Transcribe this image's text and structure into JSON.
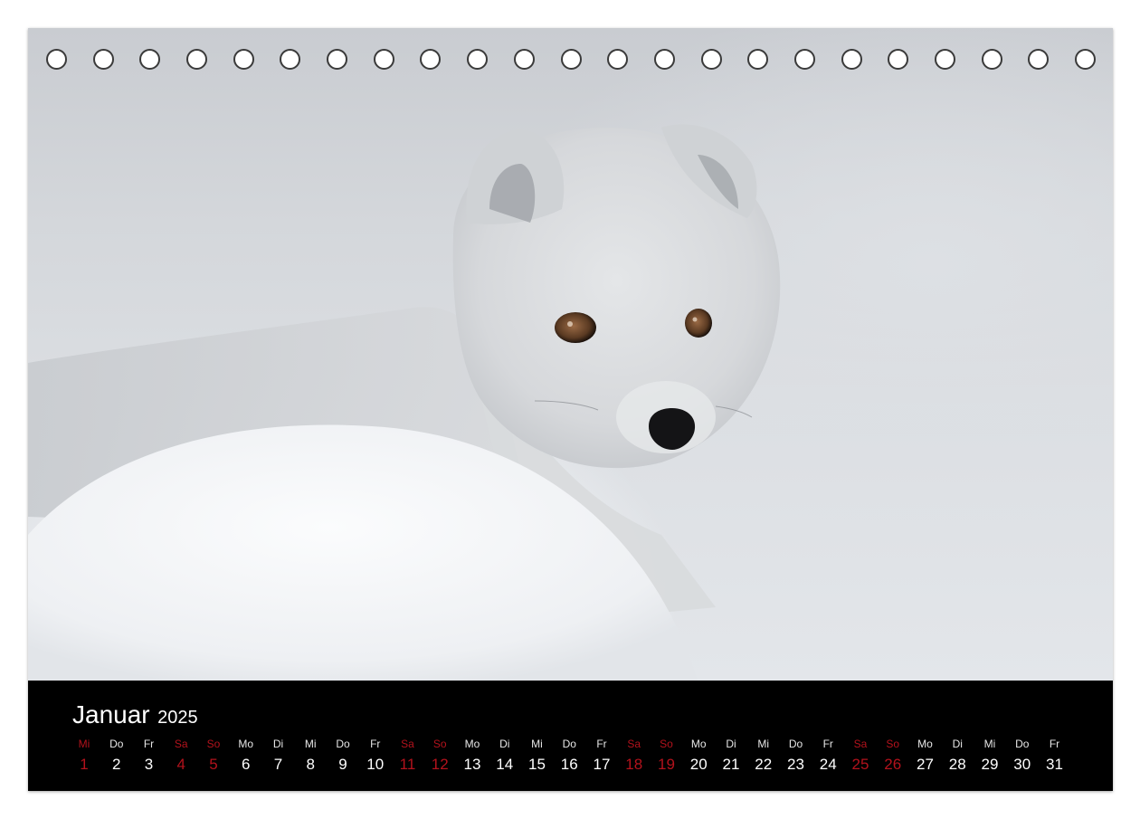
{
  "calendar": {
    "month": "Januar",
    "year": "2025",
    "weekend_color": "#b3121c",
    "days": [
      {
        "wd": "Mi",
        "n": "1",
        "weekend": true
      },
      {
        "wd": "Do",
        "n": "2",
        "weekend": false
      },
      {
        "wd": "Fr",
        "n": "3",
        "weekend": false
      },
      {
        "wd": "Sa",
        "n": "4",
        "weekend": true
      },
      {
        "wd": "So",
        "n": "5",
        "weekend": true
      },
      {
        "wd": "Mo",
        "n": "6",
        "weekend": false
      },
      {
        "wd": "Di",
        "n": "7",
        "weekend": false
      },
      {
        "wd": "Mi",
        "n": "8",
        "weekend": false
      },
      {
        "wd": "Do",
        "n": "9",
        "weekend": false
      },
      {
        "wd": "Fr",
        "n": "10",
        "weekend": false
      },
      {
        "wd": "Sa",
        "n": "11",
        "weekend": true
      },
      {
        "wd": "So",
        "n": "12",
        "weekend": true
      },
      {
        "wd": "Mo",
        "n": "13",
        "weekend": false
      },
      {
        "wd": "Di",
        "n": "14",
        "weekend": false
      },
      {
        "wd": "Mi",
        "n": "15",
        "weekend": false
      },
      {
        "wd": "Do",
        "n": "16",
        "weekend": false
      },
      {
        "wd": "Fr",
        "n": "17",
        "weekend": false
      },
      {
        "wd": "Sa",
        "n": "18",
        "weekend": true
      },
      {
        "wd": "So",
        "n": "19",
        "weekend": true
      },
      {
        "wd": "Mo",
        "n": "20",
        "weekend": false
      },
      {
        "wd": "Di",
        "n": "21",
        "weekend": false
      },
      {
        "wd": "Mi",
        "n": "22",
        "weekend": false
      },
      {
        "wd": "Do",
        "n": "23",
        "weekend": false
      },
      {
        "wd": "Fr",
        "n": "24",
        "weekend": false
      },
      {
        "wd": "Sa",
        "n": "25",
        "weekend": true
      },
      {
        "wd": "So",
        "n": "26",
        "weekend": true
      },
      {
        "wd": "Mo",
        "n": "27",
        "weekend": false
      },
      {
        "wd": "Di",
        "n": "28",
        "weekend": false
      },
      {
        "wd": "Mi",
        "n": "29",
        "weekend": false
      },
      {
        "wd": "Do",
        "n": "30",
        "weekend": false
      },
      {
        "wd": "Fr",
        "n": "31",
        "weekend": false
      }
    ]
  },
  "binding": {
    "hole_count": 23
  }
}
